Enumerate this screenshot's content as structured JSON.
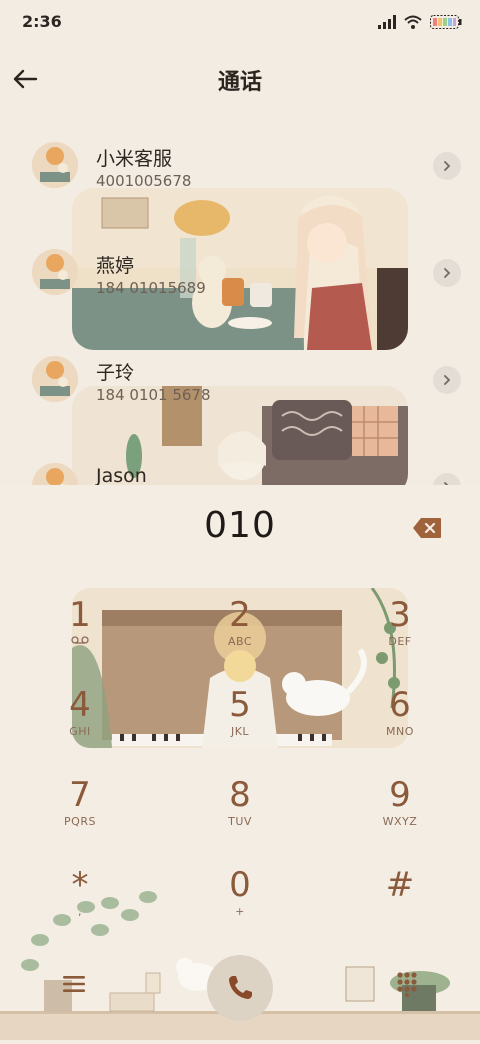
{
  "status_bar": {
    "time": "2:36",
    "icons": [
      "signal-icon",
      "wifi-icon",
      "battery-icon"
    ]
  },
  "header": {
    "title": "通话",
    "back_icon": "arrow-left-icon"
  },
  "call_log": [
    {
      "name": "小米客服",
      "number": "4001005678"
    },
    {
      "name": "燕婷",
      "number": "184 01015689"
    },
    {
      "name": "子玲",
      "number": "184 0101 5678"
    },
    {
      "name": "Jason",
      "number": ""
    }
  ],
  "dialer": {
    "input": "010",
    "keys": [
      {
        "digit": "1",
        "letters": ""
      },
      {
        "digit": "2",
        "letters": "ABC"
      },
      {
        "digit": "3",
        "letters": "DEF"
      },
      {
        "digit": "4",
        "letters": "GHI"
      },
      {
        "digit": "5",
        "letters": "JKL"
      },
      {
        "digit": "6",
        "letters": "MNO"
      },
      {
        "digit": "7",
        "letters": "PQRS"
      },
      {
        "digit": "8",
        "letters": "TUV"
      },
      {
        "digit": "9",
        "letters": "WXYZ"
      },
      {
        "digit": "*",
        "letters": ","
      },
      {
        "digit": "0",
        "letters": "+"
      },
      {
        "digit": "#",
        "letters": ""
      }
    ]
  },
  "colors": {
    "background": "#f3ece3",
    "digit": "#8a5a3a",
    "accent": "#a0623a"
  }
}
